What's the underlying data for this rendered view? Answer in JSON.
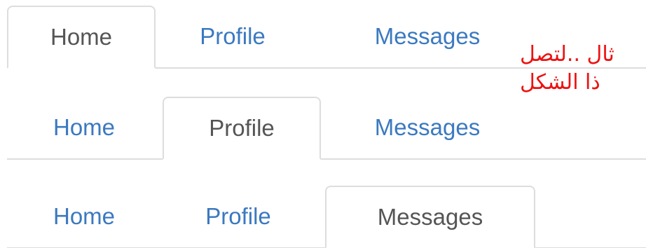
{
  "tab_groups": [
    {
      "active": "Home",
      "tabs": [
        "Home",
        "Profile",
        "Messages"
      ]
    },
    {
      "active": "Profile",
      "tabs": [
        "Home",
        "Profile",
        "Messages"
      ]
    },
    {
      "active": "Messages",
      "tabs": [
        "Home",
        "Profile",
        "Messages"
      ]
    }
  ],
  "annotation": {
    "line1": "ثال ..لتصل",
    "line2": "ذا الشكل"
  },
  "colors": {
    "link": "#3b79c0",
    "active_text": "#555555",
    "border": "#dddddd",
    "annotation": "#ee1111"
  }
}
